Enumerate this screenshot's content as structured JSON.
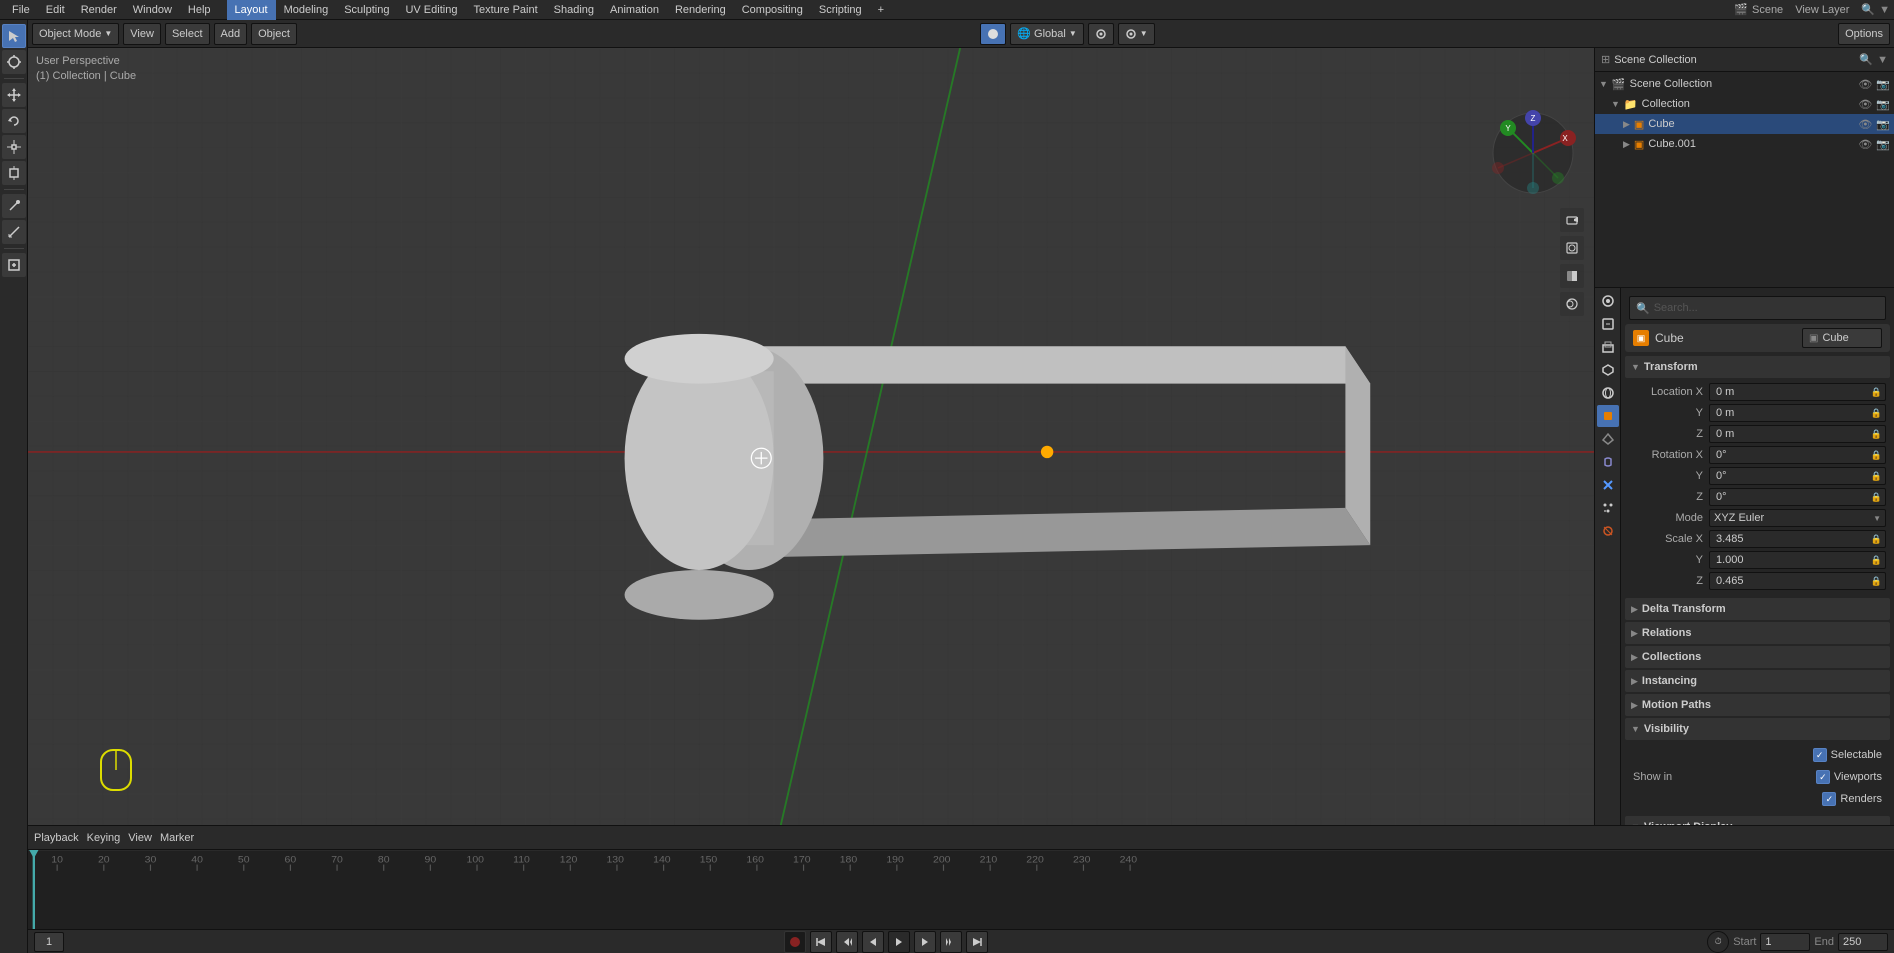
{
  "app": {
    "title": "Scene",
    "view_layer": "View Layer"
  },
  "top_menu": {
    "items": [
      "File",
      "Edit",
      "Render",
      "Window",
      "Help"
    ],
    "tabs": [
      "Layout",
      "Modeling",
      "Sculpting",
      "UV Editing",
      "Texture Paint",
      "Shading",
      "Animation",
      "Rendering",
      "Compositing",
      "Scripting"
    ],
    "active_tab": "Layout",
    "plus_btn": "+"
  },
  "header_toolbar": {
    "mode_dropdown": "Object Mode",
    "view_btn": "View",
    "select_btn": "Select",
    "add_btn": "Add",
    "object_btn": "Object",
    "global_dropdown": "Global",
    "options_btn": "Options"
  },
  "viewport": {
    "label_perspective": "User Perspective",
    "label_collection": "(1) Collection | Cube"
  },
  "outliner": {
    "title": "Scene Collection",
    "items": [
      {
        "level": 0,
        "label": "Scene Collection",
        "icon": "📁",
        "type": "scene"
      },
      {
        "level": 1,
        "label": "Collection",
        "icon": "📁",
        "type": "collection",
        "visible": true
      },
      {
        "level": 2,
        "label": "Cube",
        "icon": "▣",
        "type": "mesh",
        "selected": true,
        "visible": true
      },
      {
        "level": 2,
        "label": "Cube.001",
        "icon": "▣",
        "type": "mesh",
        "visible": true
      }
    ]
  },
  "properties": {
    "object_name": "Cube",
    "data_name": "Cube",
    "tabs": [
      "scene",
      "render",
      "output",
      "view_layer",
      "scene2",
      "world",
      "object",
      "mesh",
      "particles",
      "physics",
      "constraints",
      "object_data",
      "modifier",
      "shading"
    ],
    "active_tab": "object",
    "transform": {
      "label": "Transform",
      "location_x": "0 m",
      "location_y": "0 m",
      "location_z": "0 m",
      "rotation_x": "0°",
      "rotation_y": "0°",
      "rotation_z": "0°",
      "rotation_mode": "XYZ Euler",
      "scale_x": "3.485",
      "scale_y": "1.000",
      "scale_z": "0.465"
    },
    "sections": {
      "delta_transform": "Delta Transform",
      "relations": "Relations",
      "collections": "Collections",
      "instancing": "Instancing",
      "motion_paths": "Motion Paths",
      "visibility": "Visibility"
    },
    "visibility": {
      "selectable": "Selectable",
      "selectable_checked": true,
      "show_in": "Show in",
      "viewports": "Viewports",
      "viewports_checked": true,
      "renders": "Renders",
      "renders_checked": true
    }
  },
  "timeline": {
    "playback_btn": "Playback",
    "keying_btn": "Keying",
    "view_btn": "View",
    "marker_btn": "Marker",
    "frame_current": "1",
    "start_label": "Start",
    "start_val": "1",
    "end_label": "End",
    "end_val": "250",
    "ctrl_buttons": [
      "skip_start",
      "prev_keyframe",
      "prev_frame",
      "play",
      "next_frame",
      "next_keyframe",
      "skip_end"
    ]
  }
}
